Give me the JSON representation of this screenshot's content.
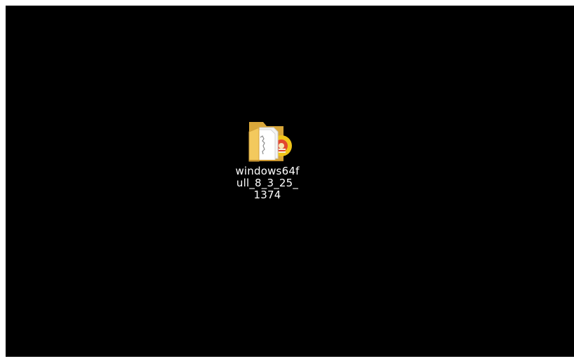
{
  "desktop": {
    "background_color": "#000000",
    "icons": [
      {
        "label": "windows64full_8_3_25_1374",
        "icon": "folder-with-disc-icon"
      }
    ]
  }
}
